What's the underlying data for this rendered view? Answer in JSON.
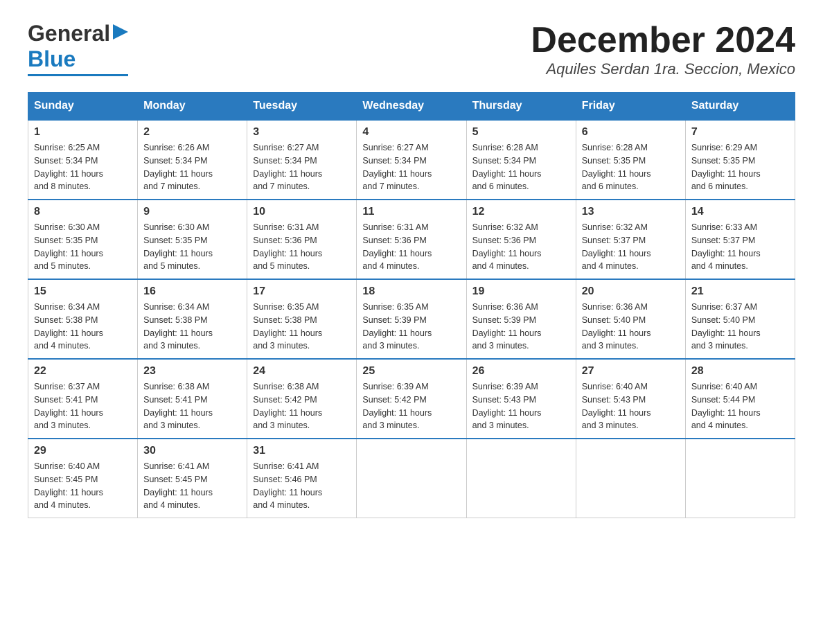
{
  "header": {
    "logo_line1": "General",
    "logo_line2": "Blue",
    "month_title": "December 2024",
    "location": "Aquiles Serdan 1ra. Seccion, Mexico"
  },
  "weekdays": [
    "Sunday",
    "Monday",
    "Tuesday",
    "Wednesday",
    "Thursday",
    "Friday",
    "Saturday"
  ],
  "weeks": [
    [
      {
        "day": "1",
        "sunrise": "6:25 AM",
        "sunset": "5:34 PM",
        "daylight": "11 hours and 8 minutes."
      },
      {
        "day": "2",
        "sunrise": "6:26 AM",
        "sunset": "5:34 PM",
        "daylight": "11 hours and 7 minutes."
      },
      {
        "day": "3",
        "sunrise": "6:27 AM",
        "sunset": "5:34 PM",
        "daylight": "11 hours and 7 minutes."
      },
      {
        "day": "4",
        "sunrise": "6:27 AM",
        "sunset": "5:34 PM",
        "daylight": "11 hours and 7 minutes."
      },
      {
        "day": "5",
        "sunrise": "6:28 AM",
        "sunset": "5:34 PM",
        "daylight": "11 hours and 6 minutes."
      },
      {
        "day": "6",
        "sunrise": "6:28 AM",
        "sunset": "5:35 PM",
        "daylight": "11 hours and 6 minutes."
      },
      {
        "day": "7",
        "sunrise": "6:29 AM",
        "sunset": "5:35 PM",
        "daylight": "11 hours and 6 minutes."
      }
    ],
    [
      {
        "day": "8",
        "sunrise": "6:30 AM",
        "sunset": "5:35 PM",
        "daylight": "11 hours and 5 minutes."
      },
      {
        "day": "9",
        "sunrise": "6:30 AM",
        "sunset": "5:35 PM",
        "daylight": "11 hours and 5 minutes."
      },
      {
        "day": "10",
        "sunrise": "6:31 AM",
        "sunset": "5:36 PM",
        "daylight": "11 hours and 5 minutes."
      },
      {
        "day": "11",
        "sunrise": "6:31 AM",
        "sunset": "5:36 PM",
        "daylight": "11 hours and 4 minutes."
      },
      {
        "day": "12",
        "sunrise": "6:32 AM",
        "sunset": "5:36 PM",
        "daylight": "11 hours and 4 minutes."
      },
      {
        "day": "13",
        "sunrise": "6:32 AM",
        "sunset": "5:37 PM",
        "daylight": "11 hours and 4 minutes."
      },
      {
        "day": "14",
        "sunrise": "6:33 AM",
        "sunset": "5:37 PM",
        "daylight": "11 hours and 4 minutes."
      }
    ],
    [
      {
        "day": "15",
        "sunrise": "6:34 AM",
        "sunset": "5:38 PM",
        "daylight": "11 hours and 4 minutes."
      },
      {
        "day": "16",
        "sunrise": "6:34 AM",
        "sunset": "5:38 PM",
        "daylight": "11 hours and 3 minutes."
      },
      {
        "day": "17",
        "sunrise": "6:35 AM",
        "sunset": "5:38 PM",
        "daylight": "11 hours and 3 minutes."
      },
      {
        "day": "18",
        "sunrise": "6:35 AM",
        "sunset": "5:39 PM",
        "daylight": "11 hours and 3 minutes."
      },
      {
        "day": "19",
        "sunrise": "6:36 AM",
        "sunset": "5:39 PM",
        "daylight": "11 hours and 3 minutes."
      },
      {
        "day": "20",
        "sunrise": "6:36 AM",
        "sunset": "5:40 PM",
        "daylight": "11 hours and 3 minutes."
      },
      {
        "day": "21",
        "sunrise": "6:37 AM",
        "sunset": "5:40 PM",
        "daylight": "11 hours and 3 minutes."
      }
    ],
    [
      {
        "day": "22",
        "sunrise": "6:37 AM",
        "sunset": "5:41 PM",
        "daylight": "11 hours and 3 minutes."
      },
      {
        "day": "23",
        "sunrise": "6:38 AM",
        "sunset": "5:41 PM",
        "daylight": "11 hours and 3 minutes."
      },
      {
        "day": "24",
        "sunrise": "6:38 AM",
        "sunset": "5:42 PM",
        "daylight": "11 hours and 3 minutes."
      },
      {
        "day": "25",
        "sunrise": "6:39 AM",
        "sunset": "5:42 PM",
        "daylight": "11 hours and 3 minutes."
      },
      {
        "day": "26",
        "sunrise": "6:39 AM",
        "sunset": "5:43 PM",
        "daylight": "11 hours and 3 minutes."
      },
      {
        "day": "27",
        "sunrise": "6:40 AM",
        "sunset": "5:43 PM",
        "daylight": "11 hours and 3 minutes."
      },
      {
        "day": "28",
        "sunrise": "6:40 AM",
        "sunset": "5:44 PM",
        "daylight": "11 hours and 4 minutes."
      }
    ],
    [
      {
        "day": "29",
        "sunrise": "6:40 AM",
        "sunset": "5:45 PM",
        "daylight": "11 hours and 4 minutes."
      },
      {
        "day": "30",
        "sunrise": "6:41 AM",
        "sunset": "5:45 PM",
        "daylight": "11 hours and 4 minutes."
      },
      {
        "day": "31",
        "sunrise": "6:41 AM",
        "sunset": "5:46 PM",
        "daylight": "11 hours and 4 minutes."
      },
      null,
      null,
      null,
      null
    ]
  ],
  "labels": {
    "sunrise": "Sunrise:",
    "sunset": "Sunset:",
    "daylight": "Daylight:"
  }
}
